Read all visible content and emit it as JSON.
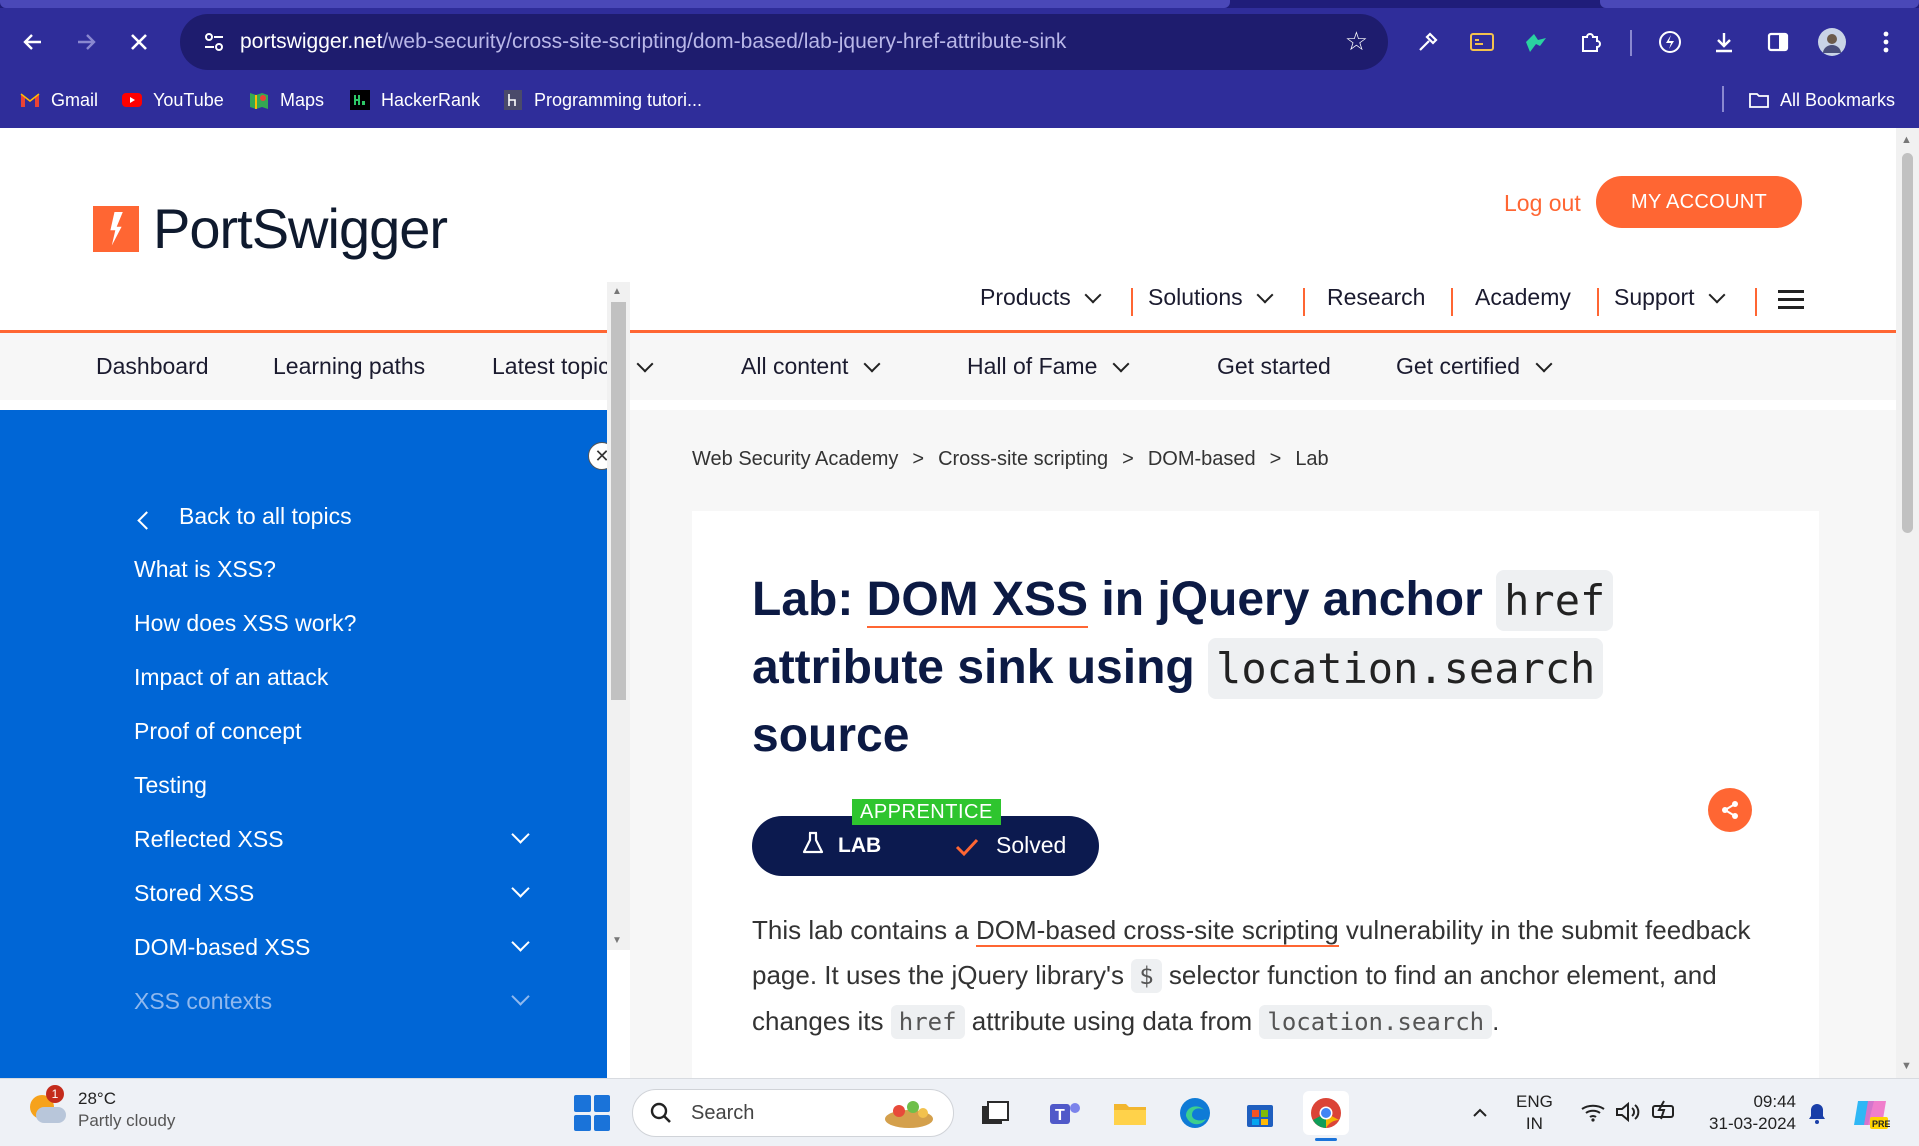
{
  "browser": {
    "url_domain": "portswigger.net",
    "url_path": "/web-security/cross-site-scripting/dom-based/lab-jquery-href-attribute-sink",
    "bookmarks": [
      {
        "label": "Gmail",
        "icon": "gmail-icon",
        "color": "#ea4335"
      },
      {
        "label": "YouTube",
        "icon": "youtube-icon",
        "color": "#ff0000"
      },
      {
        "label": "Maps",
        "icon": "maps-icon",
        "color": "#34a853"
      },
      {
        "label": "HackerRank",
        "icon": "hackerrank-icon",
        "color": "#000000"
      },
      {
        "label": "Programming tutori...",
        "icon": "bookmark-page-icon",
        "color": "#3a3a5a"
      }
    ],
    "all_bookmarks": "All Bookmarks"
  },
  "site": {
    "logo_text": "PortSwigger",
    "logout": "Log out",
    "my_account": "MY ACCOUNT",
    "main_nav": [
      "Products",
      "Solutions",
      "Research",
      "Academy",
      "Support"
    ],
    "sub_nav": [
      "Dashboard",
      "Learning paths",
      "Latest topics",
      "All content",
      "Hall of Fame",
      "Get started",
      "Get certified"
    ],
    "accent_color": "#ff6633",
    "sidebar_color": "#0066d6"
  },
  "sidebar": {
    "back": "Back to all topics",
    "items": [
      "What is XSS?",
      "How does XSS work?",
      "Impact of an attack",
      "Proof of concept",
      "Testing",
      "Reflected XSS",
      "Stored XSS",
      "DOM-based XSS",
      "XSS contexts"
    ]
  },
  "breadcrumb": [
    "Web Security Academy",
    "Cross-site scripting",
    "DOM-based",
    "Lab"
  ],
  "lab": {
    "title_prefix": "Lab: ",
    "title_link": "DOM XSS",
    "title_mid1": " in jQuery anchor ",
    "title_code1": "href",
    "title_mid2": " attribute sink using ",
    "title_code2": "location.search",
    "title_suffix": " source",
    "level": "APPRENTICE",
    "lab_label": "LAB",
    "status": "Solved"
  },
  "description": {
    "p1_a": "This lab contains a ",
    "p1_link": "DOM-based cross-site scripting",
    "p1_b": " vulnerability in the submit feedback page. It uses the jQuery library's ",
    "p1_code1": "$",
    "p1_c": " selector function to find an anchor element, and changes its ",
    "p1_code2": "href",
    "p1_d": " attribute using data from ",
    "p1_code3": "location.search",
    "p1_e": "."
  },
  "taskbar": {
    "weather_badge": "1",
    "temperature": "28°C",
    "condition": "Partly cloudy",
    "search": "Search",
    "lang1": "ENG",
    "lang2": "IN",
    "time": "09:44",
    "date": "31-03-2024"
  }
}
